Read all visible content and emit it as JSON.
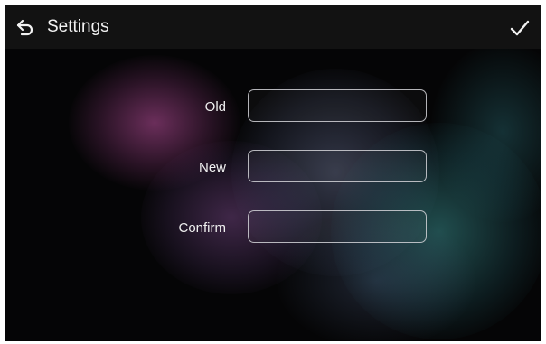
{
  "header": {
    "title": "Settings",
    "back_icon": "back-arrow-icon",
    "confirm_icon": "checkmark-icon"
  },
  "form": {
    "fields": [
      {
        "label": "Old",
        "value": "",
        "placeholder": ""
      },
      {
        "label": "New",
        "value": "",
        "placeholder": ""
      },
      {
        "label": "Confirm",
        "value": "",
        "placeholder": ""
      }
    ]
  },
  "colors": {
    "header_bg": "#121212",
    "text": "#f2f2f2",
    "field_border": "#d2d2d7"
  }
}
